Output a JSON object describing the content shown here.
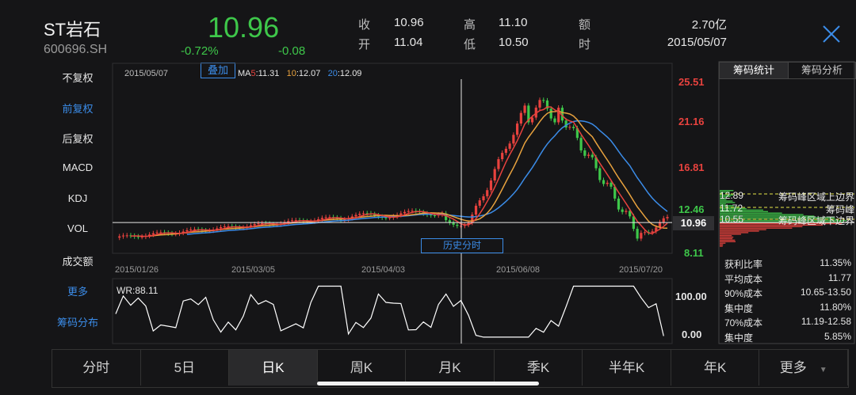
{
  "stock": {
    "name": "ST岩石",
    "code": "600696.SH",
    "price": "10.96",
    "change_pct": "-0.72%",
    "change": "-0.08"
  },
  "quote": {
    "close_label": "收",
    "close": "10.96",
    "open_label": "开",
    "open": "11.04",
    "high_label": "高",
    "high": "11.10",
    "low_label": "低",
    "low": "10.50",
    "amount_label": "额",
    "amount": "2.70亿",
    "time_label": "时",
    "time": "2015/05/07"
  },
  "left_menu": [
    {
      "label": "不复权",
      "active": false
    },
    {
      "label": "前复权",
      "active": true
    },
    {
      "label": "后复权",
      "active": false
    },
    {
      "label": "MACD",
      "active": false
    },
    {
      "label": "KDJ",
      "active": false
    },
    {
      "label": "VOL",
      "active": false
    },
    {
      "label": "成交额",
      "active": false
    },
    {
      "label": "更多",
      "active": true
    },
    {
      "label": "筹码分布",
      "active": true
    }
  ],
  "chart_header": {
    "date": "2015/05/07",
    "overlay_button": "叠加",
    "ma_label": "MA",
    "ma5_key": "5",
    "ma5_val": ":11.31",
    "ma10_key": "10",
    "ma10_val": ":12.07",
    "ma20_key": "20",
    "ma20_val": ":12.09"
  },
  "price_axis": {
    "top": "25.51",
    "second": "21.16",
    "third": "16.81",
    "fourth": "12.46",
    "bottom": "8.11",
    "current": "10.96"
  },
  "history_button": "历史分时",
  "x_dates": [
    "2015/01/26",
    "2015/03/05",
    "2015/04/03",
    "2015/06/08",
    "2015/07/20"
  ],
  "wr": {
    "label": "WR:88.11",
    "top": "100.00",
    "bottom": "0.00"
  },
  "right_tabs": {
    "stats": "筹码统计",
    "analysis": "筹码分析"
  },
  "chip_labels": {
    "upper_val": "12.89",
    "upper": "筹码峰区域上边界",
    "peak_val": "11.72",
    "peak": "筹码峰",
    "lower_val": "10.55",
    "lower": "筹码峰区域下边界"
  },
  "chip_stats": [
    {
      "label": "获利比率",
      "value": "11.35%"
    },
    {
      "label": "平均成本",
      "value": "11.77"
    },
    {
      "label": "90%成本",
      "value": "10.65-13.50"
    },
    {
      "label": "集中度",
      "value": "11.80%"
    },
    {
      "label": "70%成本",
      "value": "11.19-12.58"
    },
    {
      "label": "集中度",
      "value": "5.85%"
    }
  ],
  "bottom_tabs": [
    {
      "label": "分时",
      "active": false
    },
    {
      "label": "5日",
      "active": false
    },
    {
      "label": "日K",
      "active": true
    },
    {
      "label": "周K",
      "active": false
    },
    {
      "label": "月K",
      "active": false
    },
    {
      "label": "季K",
      "active": false
    },
    {
      "label": "半年K",
      "active": false
    },
    {
      "label": "年K",
      "active": false
    },
    {
      "label": "更多",
      "active": false
    }
  ],
  "chart_data": {
    "type": "candlestick",
    "ylim": [
      8.11,
      25.51
    ],
    "x_tick_labels": [
      "2015/01/26",
      "2015/03/05",
      "2015/04/03",
      "2015/06/08",
      "2015/07/20"
    ],
    "y_tick_labels": [
      "25.51",
      "21.16",
      "16.81",
      "12.46",
      "8.11"
    ],
    "current_price": 10.96,
    "series": [
      {
        "name": "MA5",
        "value": 11.31,
        "color": "#e8423e"
      },
      {
        "name": "MA10",
        "value": 12.07,
        "color": "#e8a23e"
      },
      {
        "name": "MA20",
        "value": 12.09,
        "color": "#3b8ce8"
      }
    ],
    "indicator": {
      "name": "WR",
      "value": 88.11,
      "ylim": [
        0,
        100
      ]
    },
    "colors": {
      "up": "#e8423e",
      "down": "#3ec74a",
      "ma5": "#e8423e",
      "ma10": "#e8a23e",
      "ma20": "#3b8ce8",
      "wr": "#ffffff"
    }
  }
}
